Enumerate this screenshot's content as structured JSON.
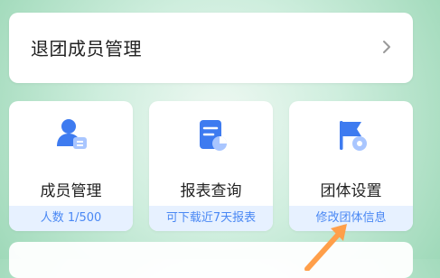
{
  "top_row": {
    "title": "退团成员管理",
    "icon": "chevron-right-icon"
  },
  "cards": [
    {
      "label": "成员管理",
      "footer": "人数 1/500",
      "icon": "member-manage-icon"
    },
    {
      "label": "报表查询",
      "footer": "可下载近7天报表",
      "icon": "report-query-icon"
    },
    {
      "label": "团体设置",
      "footer": "修改团体信息",
      "icon": "group-settings-icon"
    }
  ],
  "colors": {
    "accent_blue": "#3e7bf0",
    "footer_bg": "#e7f1ff",
    "footer_text": "#4a88f4",
    "annotation_arrow": "#ff9f4a"
  }
}
